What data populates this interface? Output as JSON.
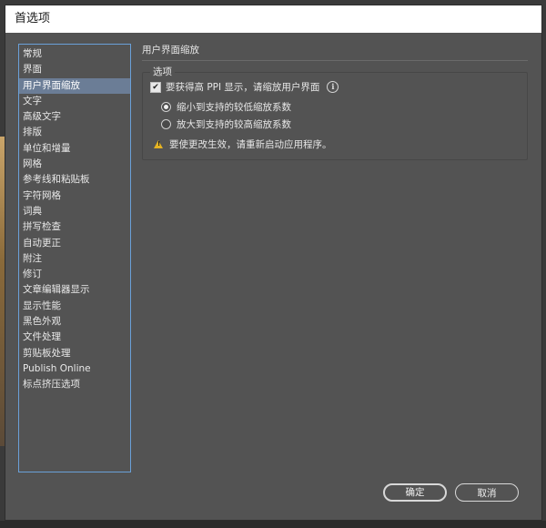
{
  "window": {
    "title": "首选项"
  },
  "sidebar": {
    "items": [
      {
        "label": "常规"
      },
      {
        "label": "界面"
      },
      {
        "label": "用户界面缩放",
        "active": true
      },
      {
        "label": "文字"
      },
      {
        "label": "高级文字"
      },
      {
        "label": "排版"
      },
      {
        "label": "单位和增量"
      },
      {
        "label": "网格"
      },
      {
        "label": "参考线和粘贴板"
      },
      {
        "label": "字符网格"
      },
      {
        "label": "词典"
      },
      {
        "label": "拼写检查"
      },
      {
        "label": "自动更正"
      },
      {
        "label": "附注"
      },
      {
        "label": "修订"
      },
      {
        "label": "文章编辑器显示"
      },
      {
        "label": "显示性能"
      },
      {
        "label": "黑色外观"
      },
      {
        "label": "文件处理"
      },
      {
        "label": "剪贴板处理"
      },
      {
        "label": "Publish Online"
      },
      {
        "label": "标点挤压选项"
      }
    ]
  },
  "main": {
    "section_title": "用户界面缩放",
    "options_group": {
      "legend": "选项",
      "checkbox_label": "要获得高 PPI 显示，请缩放用户界面",
      "checkbox_checked": true,
      "radio_options": [
        {
          "label": "缩小到支持的较低缩放系数",
          "selected": true
        },
        {
          "label": "放大到支持的较高缩放系数",
          "selected": false
        }
      ],
      "warning_text": "要使更改生效，请重新启动应用程序。"
    }
  },
  "buttons": {
    "ok": "确定",
    "cancel": "取消"
  },
  "colors": {
    "dialog_bg": "#535353",
    "selection": "#6b7d96",
    "nav_border": "#6aa0d8",
    "warning": "#e6b422"
  }
}
